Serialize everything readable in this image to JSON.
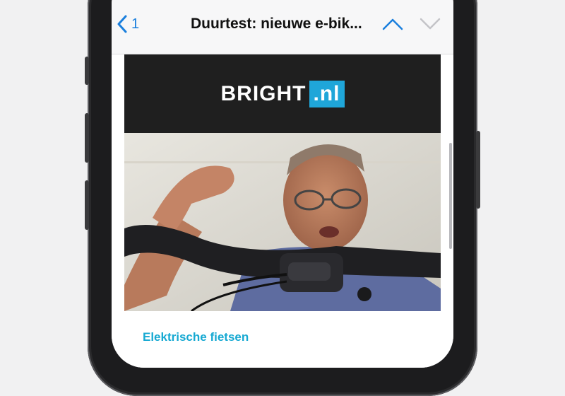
{
  "nav": {
    "back_count": "1",
    "title": "Duurtest: nieuwe e-bik..."
  },
  "newsletter": {
    "logo_main": "BRIGHT",
    "logo_tld": ".nl",
    "category": "Elektrische fietsen"
  },
  "colors": {
    "accent": "#1a7fdd",
    "brand_blue": "#1fa6d9",
    "header_bg": "#1f1f1f",
    "category": "#16a9d2"
  },
  "icons": [
    "chevron-left-icon",
    "chevron-up-icon",
    "chevron-down-icon"
  ]
}
